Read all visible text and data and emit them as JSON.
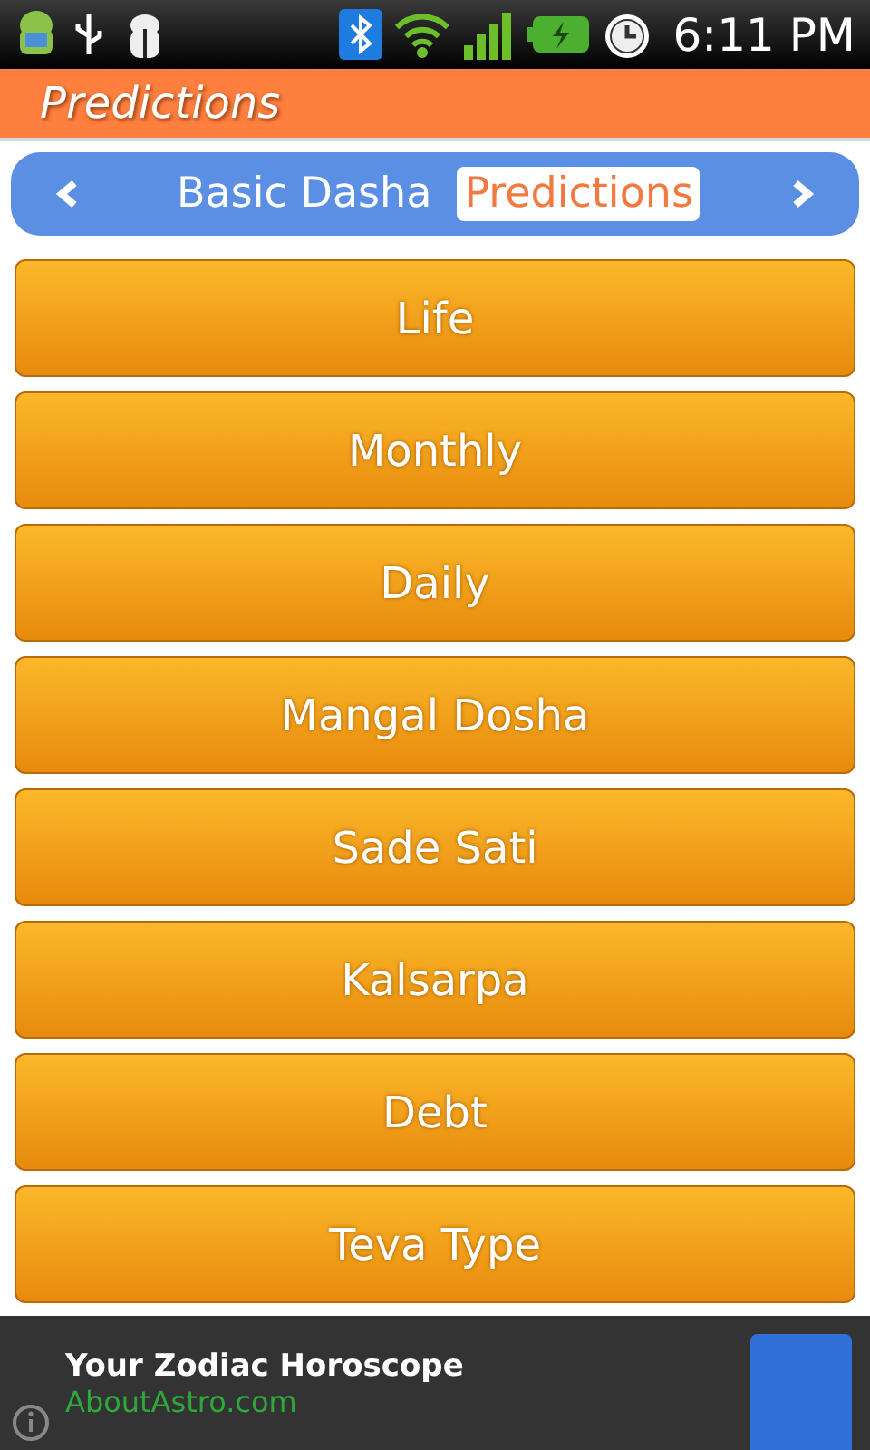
{
  "status_bar": {
    "time": "6:11 PM"
  },
  "title": "Predictions",
  "tabs": [
    {
      "label": "Basic Dasha",
      "selected": false
    },
    {
      "label": "Predictions",
      "selected": true
    }
  ],
  "menu": [
    "Life",
    "Monthly",
    "Daily",
    "Mangal Dosha",
    "Sade Sati",
    "Kalsarpa",
    "Debt",
    "Teva Type"
  ],
  "ad": {
    "headline": "Your Zodiac Horoscope",
    "url": "AboutAstro.com"
  }
}
